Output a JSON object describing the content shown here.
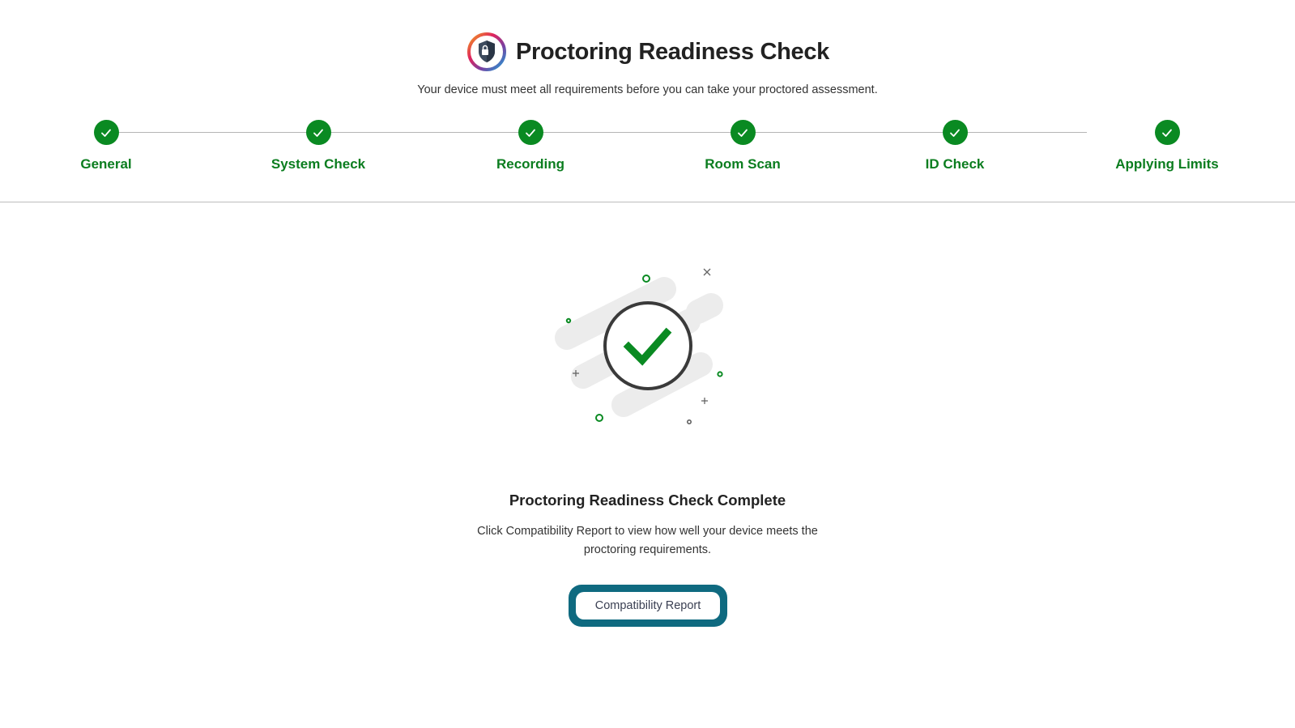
{
  "header": {
    "title": "Proctoring Readiness Check",
    "subtitle": "Your device must meet all requirements before you can take your proctored assessment."
  },
  "steps": [
    {
      "label": "General",
      "status": "complete"
    },
    {
      "label": "System Check",
      "status": "complete"
    },
    {
      "label": "Recording",
      "status": "complete"
    },
    {
      "label": "Room Scan",
      "status": "complete"
    },
    {
      "label": "ID Check",
      "status": "complete"
    },
    {
      "label": "Applying Limits",
      "status": "complete"
    }
  ],
  "result": {
    "title": "Proctoring Readiness Check Complete",
    "description": "Click Compatibility Report to view how well your device meets the proctoring requirements.",
    "button_label": "Compatibility Report"
  },
  "colors": {
    "success": "#0a8a22",
    "step_label": "#0b7d1f",
    "button_border": "#0f6a80"
  },
  "icons": {
    "logo": "shield-lock-icon",
    "step": "checkmark-icon",
    "result": "success-check-icon"
  }
}
